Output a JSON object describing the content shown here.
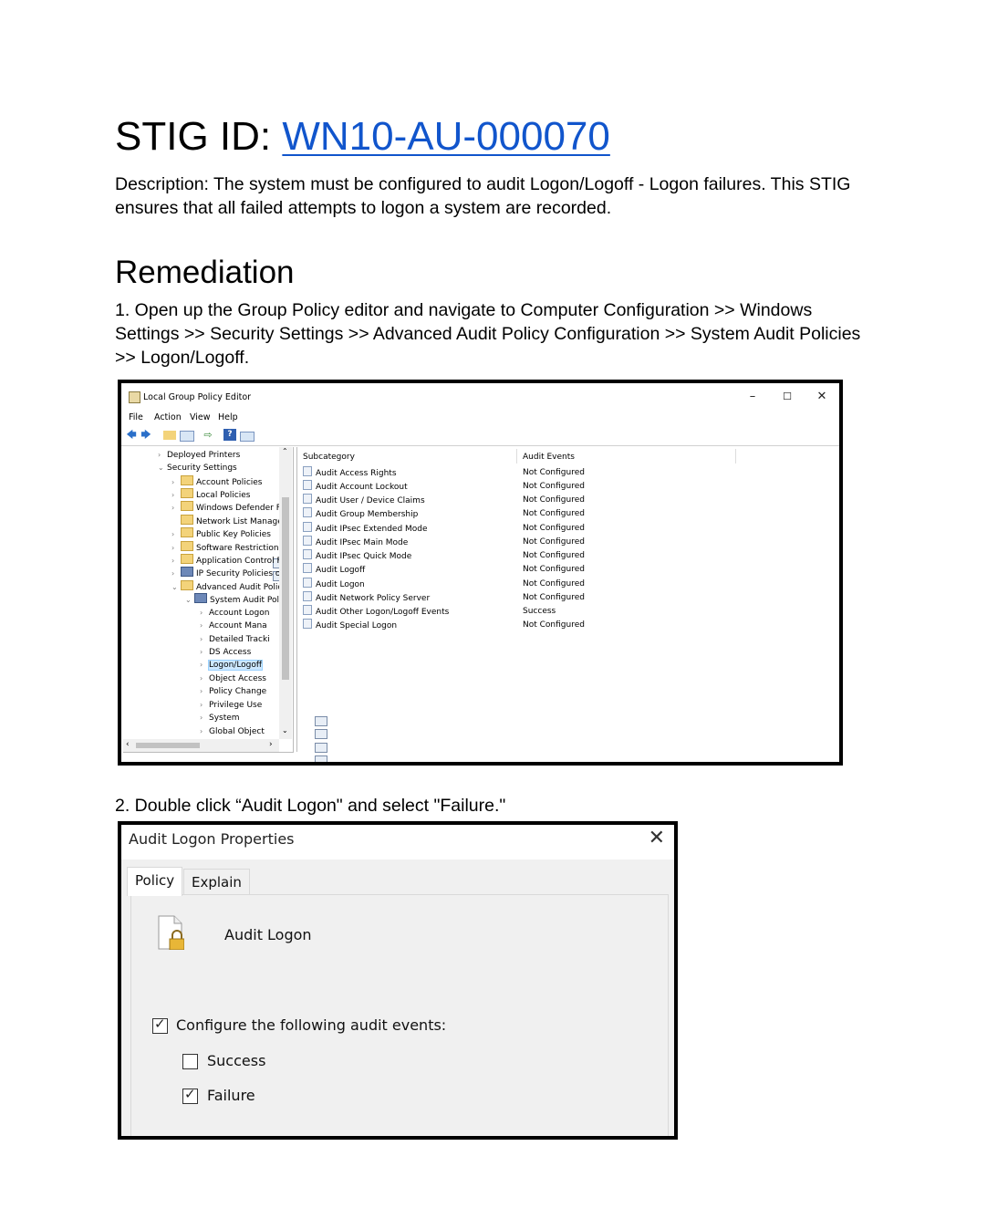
{
  "document": {
    "title_prefix": "STIG ID: ",
    "stig_id": "WN10-AU-000070",
    "description": "Description: The system must be configured to audit Logon/Logoff - Logon failures. This STIG ensures that all failed attempts to logon a system are recorded.",
    "remediation_heading": "Remediation",
    "step1": "1. Open up the Group Policy editor and navigate to Computer Configuration >> Windows Settings >> Security Settings >> Advanced Audit Policy Configuration >> System Audit Policies >> Logon/Logoff.",
    "step2": "2. Double click “Audit Logon\" and select \"Failure.\""
  },
  "gpe": {
    "window_title": "Local Group Policy Editor",
    "menu": [
      "File",
      "Action",
      "View",
      "Help"
    ],
    "tree": [
      {
        "label": "Deployed Printers",
        "icon": "printer-icon"
      },
      {
        "label": "Security Settings",
        "icon": "security-icon"
      },
      {
        "label": "Account Policies",
        "icon": "folder-icon"
      },
      {
        "label": "Local Policies",
        "icon": "folder-icon"
      },
      {
        "label": "Windows Defender Fi",
        "icon": "folder-icon"
      },
      {
        "label": "Network List Manager",
        "icon": "folder-icon"
      },
      {
        "label": "Public Key Policies",
        "icon": "folder-icon"
      },
      {
        "label": "Software Restriction P",
        "icon": "folder-icon"
      },
      {
        "label": "Application Control Po",
        "icon": "folder-icon"
      },
      {
        "label": "IP Security Policies on",
        "icon": "ip-security-icon"
      },
      {
        "label": "Advanced Audit Policy",
        "icon": "folder-icon"
      },
      {
        "label": "System Audit Polic",
        "icon": "system-icon"
      },
      {
        "label": "Account Logon",
        "icon": "policy-icon"
      },
      {
        "label": "Account Mana",
        "icon": "policy-icon"
      },
      {
        "label": "Detailed Tracki",
        "icon": "policy-icon"
      },
      {
        "label": "DS Access",
        "icon": "policy-icon"
      },
      {
        "label": "Logon/Logoff",
        "icon": "policy-icon"
      },
      {
        "label": "Object Access",
        "icon": "policy-icon"
      },
      {
        "label": "Policy Change",
        "icon": "policy-icon"
      },
      {
        "label": "Privilege Use",
        "icon": "policy-icon"
      },
      {
        "label": "System",
        "icon": "policy-icon"
      },
      {
        "label": "Global Object",
        "icon": "policy-icon"
      }
    ],
    "list_headers": [
      "Subcategory",
      "Audit Events"
    ],
    "rows": [
      {
        "name": "Audit Access Rights",
        "value": "Not Configured"
      },
      {
        "name": "Audit Account Lockout",
        "value": "Not Configured"
      },
      {
        "name": "Audit User / Device Claims",
        "value": "Not Configured"
      },
      {
        "name": "Audit Group Membership",
        "value": "Not Configured"
      },
      {
        "name": "Audit IPsec Extended Mode",
        "value": "Not Configured"
      },
      {
        "name": "Audit IPsec Main Mode",
        "value": "Not Configured"
      },
      {
        "name": "Audit IPsec Quick Mode",
        "value": "Not Configured"
      },
      {
        "name": "Audit Logoff",
        "value": "Not Configured"
      },
      {
        "name": "Audit Logon",
        "value": "Not Configured"
      },
      {
        "name": "Audit Network Policy Server",
        "value": "Not Configured"
      },
      {
        "name": "Audit Other Logon/Logoff Events",
        "value": "Success"
      },
      {
        "name": "Audit Special Logon",
        "value": "Not Configured"
      }
    ]
  },
  "dialog": {
    "title": "Audit Logon Properties",
    "tabs": [
      "Policy",
      "Explain"
    ],
    "policy_name": "Audit Logon",
    "configure_label": "Configure the following audit events:",
    "configure_checked": true,
    "success_label": "Success",
    "success_checked": false,
    "failure_label": "Failure",
    "failure_checked": true
  }
}
